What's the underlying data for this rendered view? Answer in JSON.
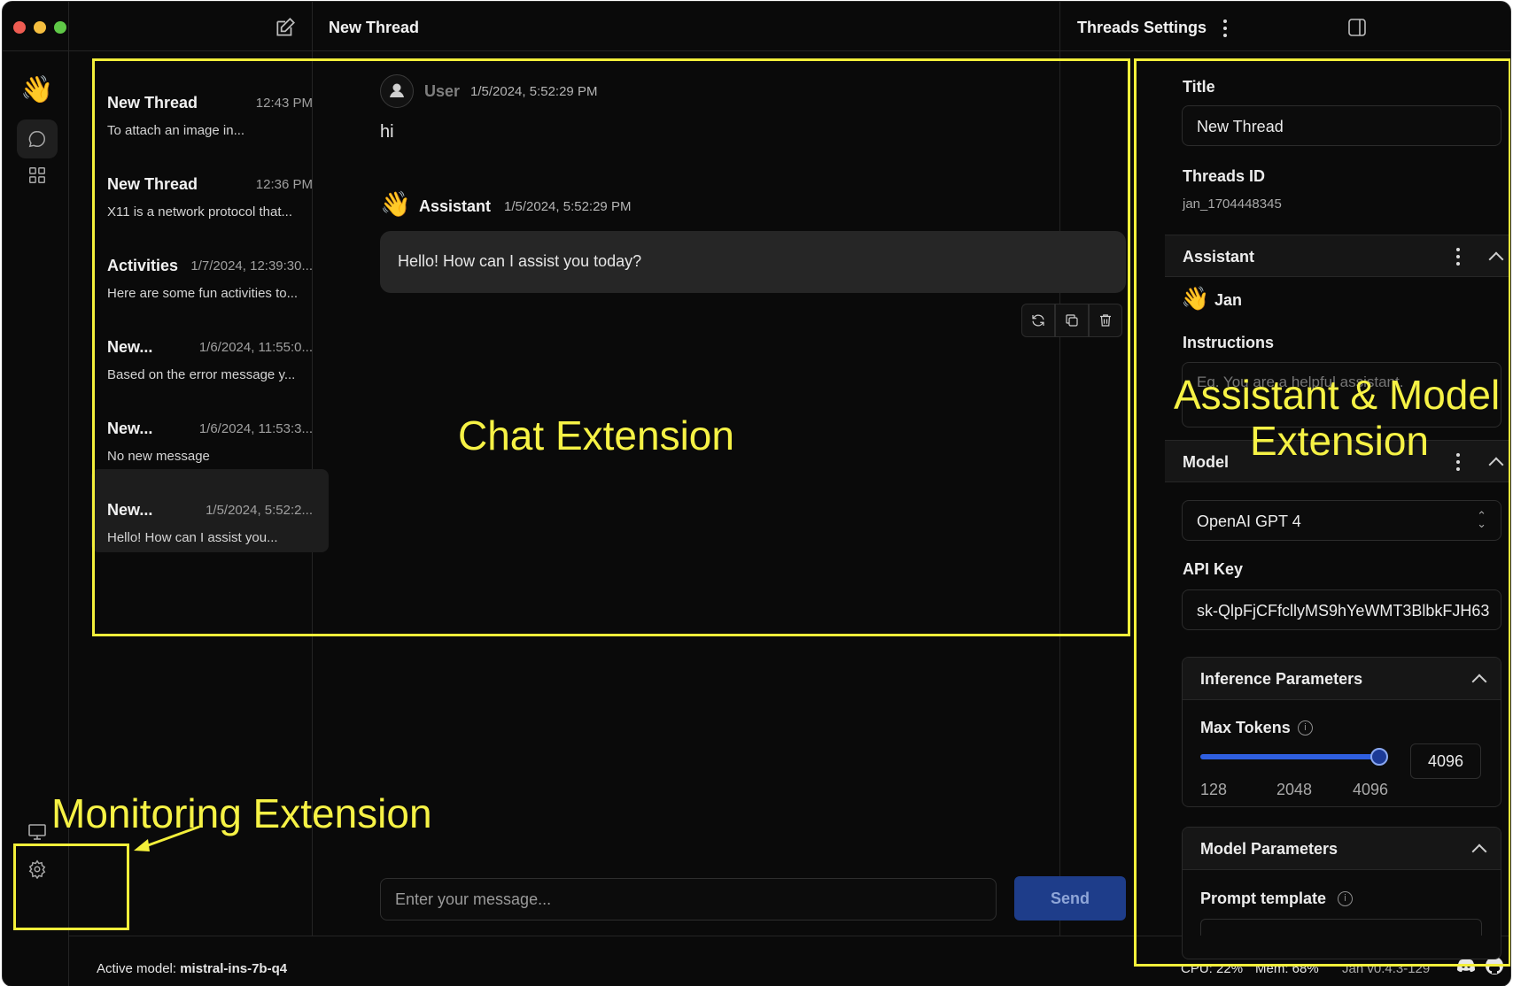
{
  "header": {
    "thread_title": "New Thread",
    "settings_title": "Threads Settings"
  },
  "threads": [
    {
      "title": "New Thread",
      "time": "12:43 PM",
      "preview": "To attach an image in..."
    },
    {
      "title": "New Thread",
      "time": "12:36 PM",
      "preview": "X11 is a network protocol that..."
    },
    {
      "title": "Activities",
      "time": "1/7/2024, 12:39:30...",
      "preview": "Here are some fun activities to..."
    },
    {
      "title": "New...",
      "time": "1/6/2024, 11:55:0...",
      "preview": "Based on the error message y..."
    },
    {
      "title": "New...",
      "time": "1/6/2024, 11:53:3...",
      "preview": "No new message"
    },
    {
      "title": "New...",
      "time": "1/5/2024, 5:52:2...",
      "preview": "Hello! How can I assist you..."
    }
  ],
  "chat": {
    "user_name": "User",
    "user_time": "1/5/2024, 5:52:29 PM",
    "user_message": "hi",
    "assistant_name": "Assistant",
    "assistant_time": "1/5/2024, 5:52:29 PM",
    "assistant_message": "Hello! How can I assist you today?",
    "input_placeholder": "Enter your message...",
    "send_label": "Send"
  },
  "settings": {
    "title_label": "Title",
    "title_value": "New Thread",
    "thread_id_label": "Threads ID",
    "thread_id_value": "jan_1704448345",
    "assistant_section": "Assistant",
    "assistant_name": "Jan",
    "instructions_label": "Instructions",
    "instructions_placeholder": "Eg. You are a helpful assistant.",
    "model_section": "Model",
    "model_value": "OpenAI GPT 4",
    "api_key_label": "API Key",
    "api_key_value": "sk-QlpFjCFfcllyMS9hYeWMT3BlbkFJH63",
    "inference_section": "Inference Parameters",
    "max_tokens_label": "Max Tokens",
    "max_tokens_value": "4096",
    "max_tokens_fraction": 0.97,
    "max_tokens_ticks": [
      "128",
      "2048",
      "4096"
    ],
    "model_params_section": "Model Parameters",
    "prompt_template_label": "Prompt template"
  },
  "status_bar": {
    "active_model_label": "Active model:",
    "active_model_value": "mistral-ins-7b-q4",
    "cpu": "CPU: 22%",
    "mem": "Mem: 68%",
    "version": "Jan v0.4.3-129"
  },
  "annotations": {
    "chat": "Chat Extension",
    "assistant_model_line1": "Assistant & Model",
    "assistant_model_line2": "Extension",
    "monitoring": "Monitoring Extension"
  },
  "colors": {
    "annotation": "#f3ef3a",
    "send_button": "#1e3d8a",
    "slider_fill": "#2f5fe0",
    "close": "#ee5c52",
    "minimize": "#f5be3f",
    "maximize": "#5fc847"
  }
}
